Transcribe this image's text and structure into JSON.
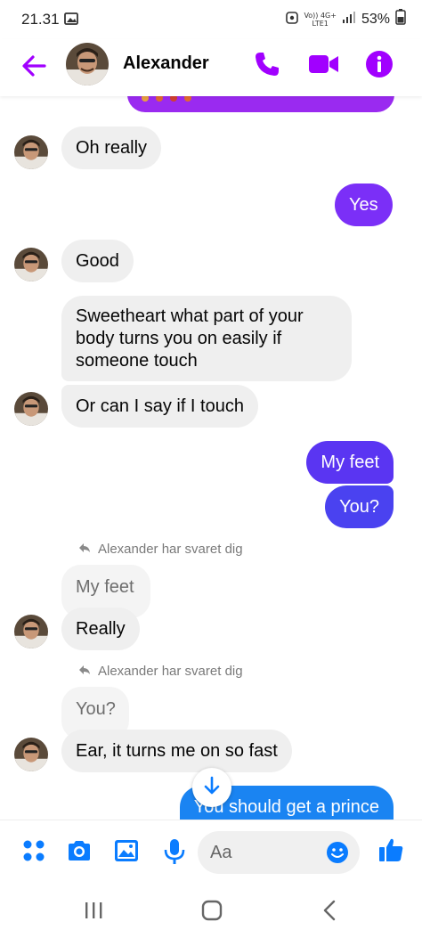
{
  "status_bar": {
    "time": "21.31",
    "network_top": "Vo)) 4G+",
    "network_bottom": "LTE1",
    "battery": "53%"
  },
  "header": {
    "contact_name": "Alexander",
    "icons": [
      "back-arrow-icon",
      "phone-icon",
      "video-camera-icon",
      "info-icon"
    ],
    "accent_color": "#a100ff"
  },
  "messages": [
    {
      "from": "them",
      "text": "Oh really"
    },
    {
      "from": "me",
      "text": "Yes"
    },
    {
      "from": "them",
      "text": "Good"
    },
    {
      "from": "them",
      "text": "Sweetheart what part of your body turns you on easily if someone touch"
    },
    {
      "from": "them",
      "text": "Or can I say if I touch"
    },
    {
      "from": "me",
      "text": "My feet"
    },
    {
      "from": "me",
      "text": "You?"
    },
    {
      "from": "them",
      "reply_notice": "Alexander har svaret dig",
      "quoted": "My feet",
      "text": "Really"
    },
    {
      "from": "them",
      "reply_notice": "Alexander har svaret dig",
      "quoted": "You?",
      "text": "Ear, it turns me on so fast"
    },
    {
      "from": "me",
      "text": "You should get a prince"
    }
  ],
  "composer": {
    "placeholder": "Aa",
    "icons": [
      "apps-icon",
      "camera-icon",
      "gallery-icon",
      "microphone-icon",
      "emoji-icon",
      "like-icon"
    ]
  },
  "colors": {
    "outgoing_bubble": "#7b2ff7",
    "incoming_bubble": "#efefef",
    "composer_icons": "#0a7cff"
  }
}
